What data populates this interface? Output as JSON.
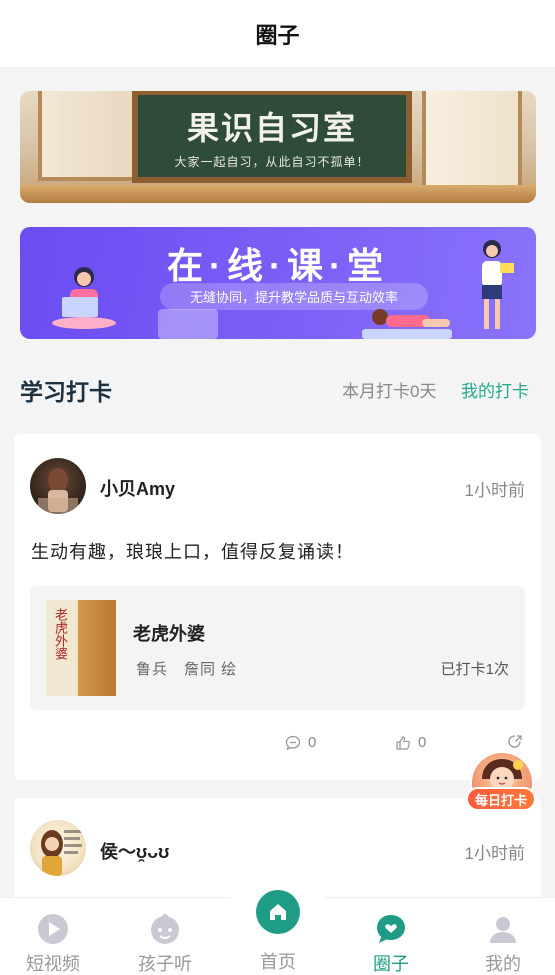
{
  "header": {
    "title": "圈子"
  },
  "banners": {
    "study_room": {
      "title": "果识自习室",
      "subtitle": "大家一起自习，从此自习不孤单！"
    },
    "online_class": {
      "title": "在·线·课·堂",
      "subtitle": "无缝协同，提升教学品质与互动效率"
    }
  },
  "checkin_section": {
    "title": "学习打卡",
    "month_count": "本月打卡0天",
    "my_checkin": "我的打卡"
  },
  "posts": [
    {
      "username": "小贝Amy",
      "time": "1小时前",
      "content": "生动有趣，琅琅上口，值得反复诵读！",
      "book": {
        "cover_text": "老虎外婆",
        "title": "老虎外婆",
        "authors": "鲁兵　詹同 绘",
        "status": "已打卡1次"
      },
      "comments": "0",
      "likes": "0"
    },
    {
      "username": "侯～ʊ̯ᴗʊ",
      "time": "1小时前"
    }
  ],
  "floating_badge": {
    "label": "每日打卡"
  },
  "tabbar": {
    "items": [
      {
        "label": "短视频",
        "icon": "play-icon"
      },
      {
        "label": "孩子听",
        "icon": "kid-face-icon"
      },
      {
        "label": "首页",
        "icon": "home-icon"
      },
      {
        "label": "圈子",
        "icon": "chat-heart-icon"
      },
      {
        "label": "我的",
        "icon": "person-icon"
      }
    ],
    "active": "圈子"
  },
  "colors": {
    "accent": "#1f9c85",
    "link_green": "#25a98f",
    "badge_orange": "#ff5a3d",
    "banner_purple": "#6a4cf2"
  }
}
